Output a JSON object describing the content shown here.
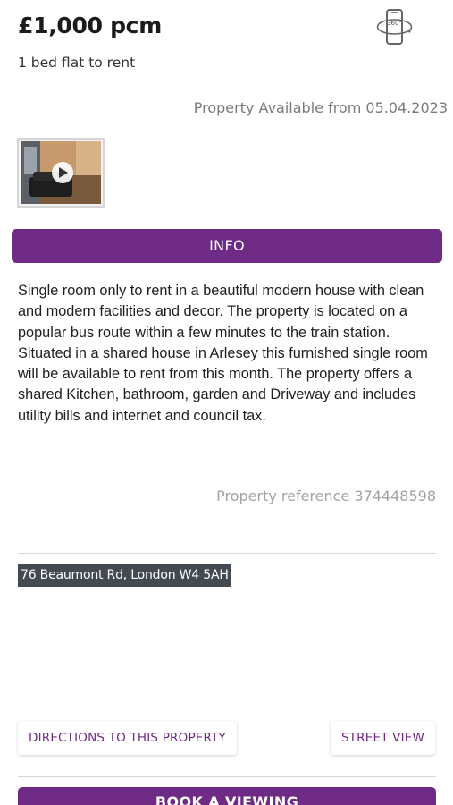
{
  "listing": {
    "price": "£1,000 pcm",
    "subtitle": "1 bed flat to rent",
    "availability": "Property Available from 05.04.2023",
    "vr_icon": "360-view-phone-icon",
    "thumbnail_icon": "play-icon"
  },
  "info": {
    "heading": "INFO",
    "description": "Single room only to rent in a beautiful modern house with clean and modern facilities and decor. The property is located on a popular bus route within a few minutes to the train station. Situated in a shared house in Arlesey this furnished single room will be available to rent from this month. The property offers a shared Kitchen, bathroom, garden and Driveway and includes utility bills and internet and council tax.",
    "reference": "Property reference 374448598"
  },
  "location": {
    "address": "76 Beaumont Rd, London W4 5AH"
  },
  "actions": {
    "directions_label": "DIRECTIONS TO THIS PROPERTY",
    "street_view_label": "STREET VIEW",
    "book_label": "BOOK A VIEWING"
  },
  "colors": {
    "brand_purple": "#6e2a84",
    "muted_text": "#7a7a7a",
    "address_bg": "#444a51"
  }
}
